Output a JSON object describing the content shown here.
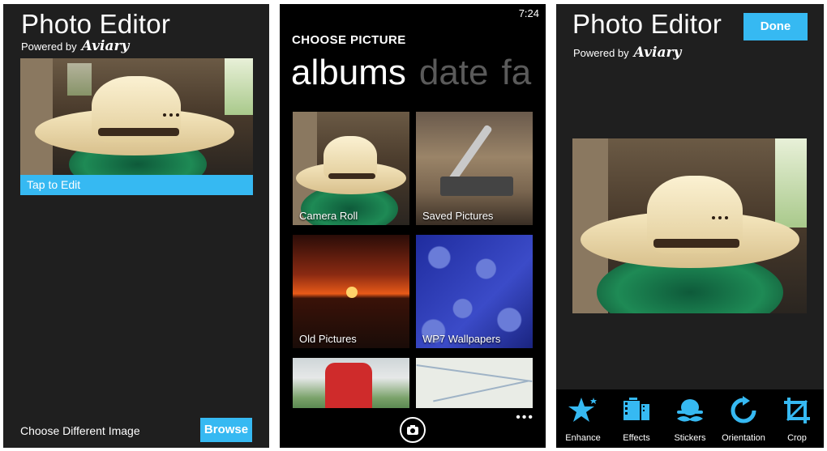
{
  "screen1": {
    "title": "Photo Editor",
    "powered_by": "Powered by",
    "brand": "Aviary",
    "tap_to_edit": "Tap to Edit",
    "choose_different": "Choose Different Image",
    "browse_label": "Browse"
  },
  "screen2": {
    "time": "7:24",
    "heading": "CHOOSE PICTURE",
    "pivot": {
      "active": "albums",
      "next1": "date",
      "next2": "fa"
    },
    "albums": [
      {
        "label": "Camera Roll"
      },
      {
        "label": "Saved Pictures"
      },
      {
        "label": "Old Pictures"
      },
      {
        "label": "WP7 Wallpapers"
      }
    ],
    "more_dots": "•••"
  },
  "screen3": {
    "title": "Photo Editor",
    "powered_by": "Powered by",
    "brand": "Aviary",
    "done_label": "Done",
    "tools": [
      {
        "label": "Enhance",
        "icon": "star-icon"
      },
      {
        "label": "Effects",
        "icon": "film-icon"
      },
      {
        "label": "Stickers",
        "icon": "mustache-hat-icon"
      },
      {
        "label": "Orientation",
        "icon": "rotate-icon"
      },
      {
        "label": "Crop",
        "icon": "crop-icon"
      }
    ]
  },
  "colors": {
    "accent": "#36b9f2",
    "panel_bg": "#1f1f1f",
    "black": "#000000",
    "text": "#ffffff"
  }
}
